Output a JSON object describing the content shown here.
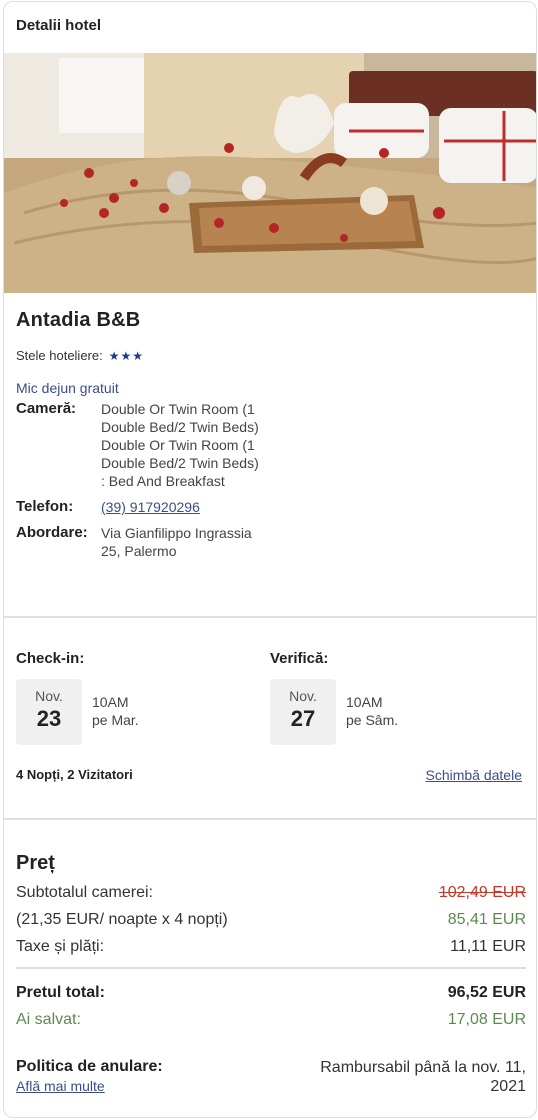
{
  "header": {
    "title": "Detalii hotel"
  },
  "hotel": {
    "name": "Antadia B&B",
    "stars_label": "Stele hoteliere:",
    "stars": "★★★",
    "breakfast": "Mic dejun gratuit",
    "room_label": "Cameră:",
    "room_value": "Double Or Twin Room (1 Double Bed/2 Twin Beds) Double Or Twin Room (1 Double Bed/2 Twin Beds) : Bed And Breakfast",
    "phone_label": "Telefon:",
    "phone_value": "(39) 917920296",
    "address_label": "Abordare:",
    "address_value": "Via Gianfilippo Ingrassia 25, Palermo"
  },
  "checkin": {
    "title": "Check-in:",
    "month": "Nov.",
    "day": "23",
    "time": "10AM",
    "weekday": "pe Mar."
  },
  "checkout": {
    "title": "Verifică:",
    "month": "Nov.",
    "day": "27",
    "time": "10AM",
    "weekday": "pe Sâm."
  },
  "stay": {
    "summary": "4 Nopți, 2 Vizitatori",
    "change_link": "Schimbă datele"
  },
  "price": {
    "title": "Preț",
    "subtotal_label": "Subtotalul camerei:",
    "subtotal_old": "102,49 EUR",
    "per_night_label": "(21,35 EUR/ noapte x 4 nopți)",
    "per_night_value": "85,41 EUR",
    "taxes_label": "Taxe și plăți:",
    "taxes_value": "11,11 EUR",
    "total_label": "Pretul total:",
    "total_value": "96,52 EUR",
    "saved_label": "Ai salvat:",
    "saved_value": "17,08 EUR"
  },
  "policy": {
    "label": "Politica de anulare:",
    "link": "Află mai multe",
    "value": "Rambursabil până la nov. 11, 2021"
  },
  "colors": {
    "link": "#3b4d8c",
    "saved": "#5d8a4f",
    "strike": "#c0392b"
  }
}
